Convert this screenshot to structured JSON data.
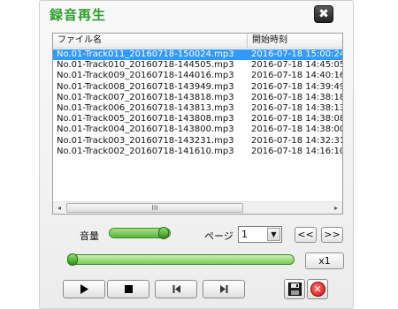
{
  "window": {
    "title": "録音再生",
    "close_glyph": "✖"
  },
  "list": {
    "columns": [
      "ファイル名",
      "開始時刻"
    ],
    "rows": [
      {
        "name": "No.01-Track011_20160718-150024.mp3",
        "time": "2016-07-18 15:00:24",
        "selected": true
      },
      {
        "name": "No.01-Track010_20160718-144505.mp3",
        "time": "2016-07-18 14:45:05",
        "selected": false
      },
      {
        "name": "No.01-Track009_20160718-144016.mp3",
        "time": "2016-07-18 14:40:16",
        "selected": false
      },
      {
        "name": "No.01-Track008_20160718-143949.mp3",
        "time": "2016-07-18 14:39:49",
        "selected": false
      },
      {
        "name": "No.01-Track007_20160718-143818.mp3",
        "time": "2016-07-18 14:38:18",
        "selected": false
      },
      {
        "name": "No.01-Track006_20160718-143813.mp3",
        "time": "2016-07-18 14:38:13",
        "selected": false
      },
      {
        "name": "No.01-Track005_20160718-143808.mp3",
        "time": "2016-07-18 14:38:08",
        "selected": false
      },
      {
        "name": "No.01-Track004_20160718-143800.mp3",
        "time": "2016-07-18 14:38:00",
        "selected": false
      },
      {
        "name": "No.01-Track003_20160718-143231.mp3",
        "time": "2016-07-18 14:32:31",
        "selected": false
      },
      {
        "name": "No.01-Track002_20160718-141610.mp3",
        "time": "2016-07-18 14:16:10",
        "selected": false
      }
    ],
    "scroll_left_glyph": "◂",
    "scroll_right_glyph": "▸",
    "scroll_thumb_glyph": "III"
  },
  "controls": {
    "volume_label": "音量",
    "page_label": "ページ",
    "page_value": "1",
    "page_arrow": "▼",
    "prev_page": "<<",
    "next_page": ">>",
    "speed": "x1"
  },
  "colors": {
    "title": "#2f9e2f",
    "selection": "#3399ff",
    "slider": "#5cb33c",
    "delete": "#d11313"
  },
  "icons": [
    "close-icon",
    "play-icon",
    "stop-icon",
    "previous-track-icon",
    "next-track-icon",
    "save-icon",
    "delete-icon"
  ]
}
